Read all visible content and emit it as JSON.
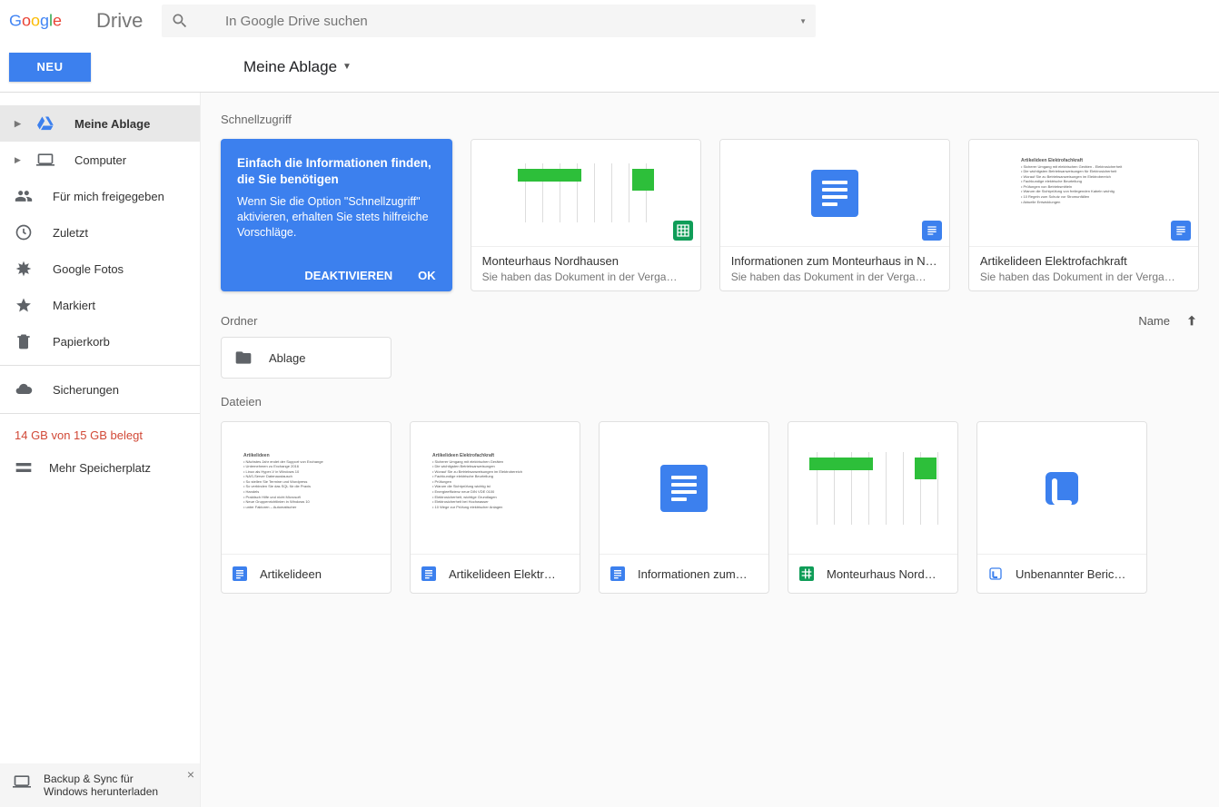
{
  "header": {
    "logo_text": "Drive",
    "search_placeholder": "In Google Drive suchen"
  },
  "subheader": {
    "new_button": "NEU",
    "breadcrumb": "Meine Ablage"
  },
  "sidebar": {
    "items": [
      {
        "label": "Meine Ablage"
      },
      {
        "label": "Computer"
      },
      {
        "label": "Für mich freigegeben"
      },
      {
        "label": "Zuletzt"
      },
      {
        "label": "Google Fotos"
      },
      {
        "label": "Markiert"
      },
      {
        "label": "Papierkorb"
      },
      {
        "label": "Sicherungen"
      }
    ],
    "storage_text": "14 GB von 15 GB belegt",
    "more_storage": "Mehr Speicherplatz",
    "backup_promo_line1": "Backup & Sync für",
    "backup_promo_line2": "Windows herunterladen"
  },
  "sections": {
    "quick_access": "Schnellzugriff",
    "folders": "Ordner",
    "files": "Dateien",
    "sort_label": "Name"
  },
  "promo": {
    "title": "Einfach die Informationen finden, die Sie benötigen",
    "body": "Wenn Sie die Option \"Schnellzugriff\" aktivieren, erhalten Sie stets hilfreiche Vorschläge.",
    "deactivate": "DEAKTIVIEREN",
    "ok": "OK"
  },
  "quick_cards": [
    {
      "title": "Monteurhaus Nordhausen",
      "subtitle": "Sie haben das Dokument in der Verga…",
      "type": "sheets"
    },
    {
      "title": "Informationen zum Monteurhaus in N…",
      "subtitle": "Sie haben das Dokument in der Verga…",
      "type": "docs"
    },
    {
      "title": "Artikelideen Elektrofachkraft",
      "subtitle": "Sie haben das Dokument in der Verga…",
      "type": "docs"
    }
  ],
  "folders": [
    {
      "name": "Ablage"
    }
  ],
  "files": [
    {
      "name": "Artikelideen",
      "type": "docs"
    },
    {
      "name": "Artikelideen Elektr…",
      "type": "docs"
    },
    {
      "name": "Informationen zum…",
      "type": "docs"
    },
    {
      "name": "Monteurhaus Nord…",
      "type": "sheets"
    },
    {
      "name": "Unbenannter Beric…",
      "type": "report"
    }
  ]
}
